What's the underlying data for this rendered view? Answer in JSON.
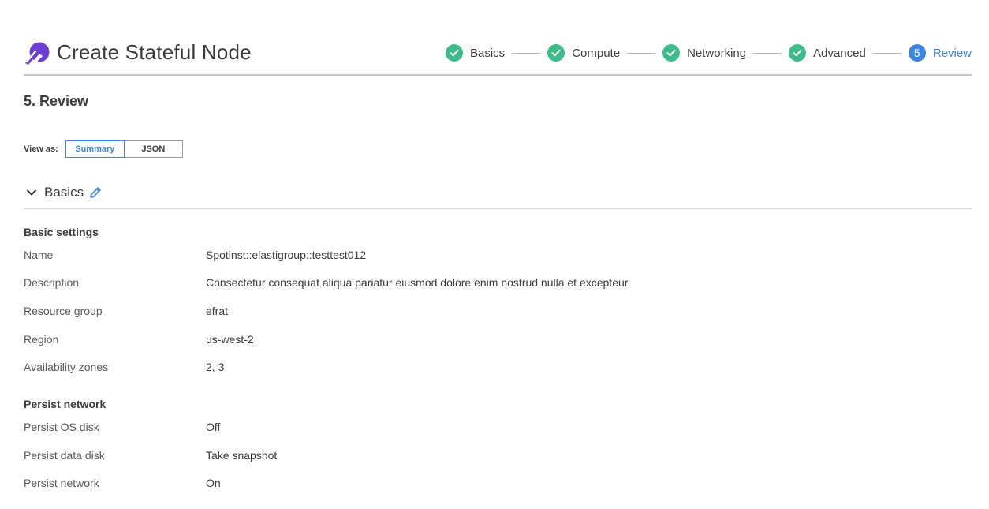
{
  "header": {
    "title": "Create Stateful Node",
    "steps": [
      {
        "label": "Basics",
        "state": "done"
      },
      {
        "label": "Compute",
        "state": "done"
      },
      {
        "label": "Networking",
        "state": "done"
      },
      {
        "label": "Advanced",
        "state": "done"
      },
      {
        "label": "Review",
        "number": "5",
        "state": "active"
      }
    ]
  },
  "section": {
    "title": "5. Review"
  },
  "view_as": {
    "label": "View as:",
    "options": [
      "Summary",
      "JSON"
    ],
    "selected": "Summary"
  },
  "group": {
    "title": "Basics"
  },
  "basic_settings": {
    "heading": "Basic settings",
    "rows": [
      {
        "label": "Name",
        "value": "Spotinst::elastigroup::testtest012"
      },
      {
        "label": "Description",
        "value": "Consectetur consequat aliqua pariatur eiusmod dolore enim nostrud nulla et excepteur."
      },
      {
        "label": "Resource group",
        "value": "efrat"
      },
      {
        "label": "Region",
        "value": "us-west-2"
      },
      {
        "label": "Availability zones",
        "value": "2, 3"
      }
    ]
  },
  "persist_network": {
    "heading": "Persist network",
    "rows": [
      {
        "label": "Persist OS disk",
        "value": "Off"
      },
      {
        "label": "Persist data disk",
        "value": "Take snapshot"
      },
      {
        "label": "Persist network",
        "value": "On"
      }
    ]
  },
  "colors": {
    "accent": "#3e86df",
    "success": "#3dbb8a",
    "logo": "#6b3fd4"
  },
  "icons": [
    "logo-icon",
    "check-icon",
    "chevron-down-icon",
    "pencil-icon"
  ]
}
